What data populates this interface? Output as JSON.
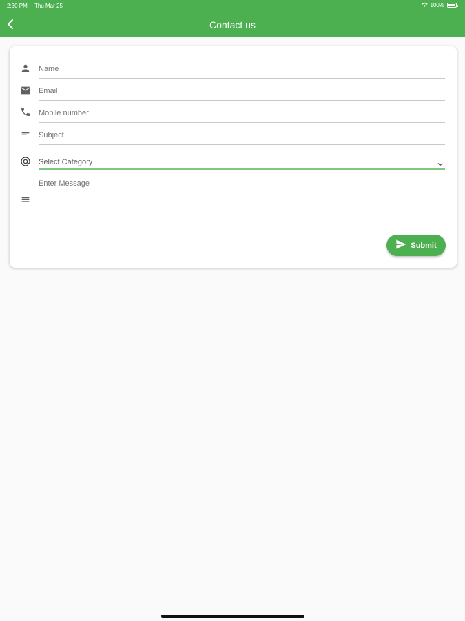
{
  "status_bar": {
    "time": "2:30 PM",
    "date": "Thu Mar 25",
    "battery": "100%",
    "battery_level": 1.0
  },
  "appbar": {
    "title": "Contact us",
    "back_icon": "chevron-left-icon",
    "color": "#4caf50"
  },
  "form": {
    "name": {
      "placeholder": "Name",
      "icon": "person-icon"
    },
    "email": {
      "placeholder": "Email",
      "icon": "mail-icon"
    },
    "mobile": {
      "placeholder": "Mobile number",
      "icon": "phone-icon"
    },
    "subject": {
      "placeholder": "Subject",
      "icon": "short-text-icon"
    },
    "category": {
      "value": "Select Category",
      "icon": "at-icon",
      "dropdown_icon": "chevron-down-icon"
    },
    "message": {
      "placeholder": "Enter Message",
      "icon": "notes-icon"
    },
    "submit_label": "Submit",
    "submit_icon": "send-icon",
    "accent": "#4caf50"
  }
}
